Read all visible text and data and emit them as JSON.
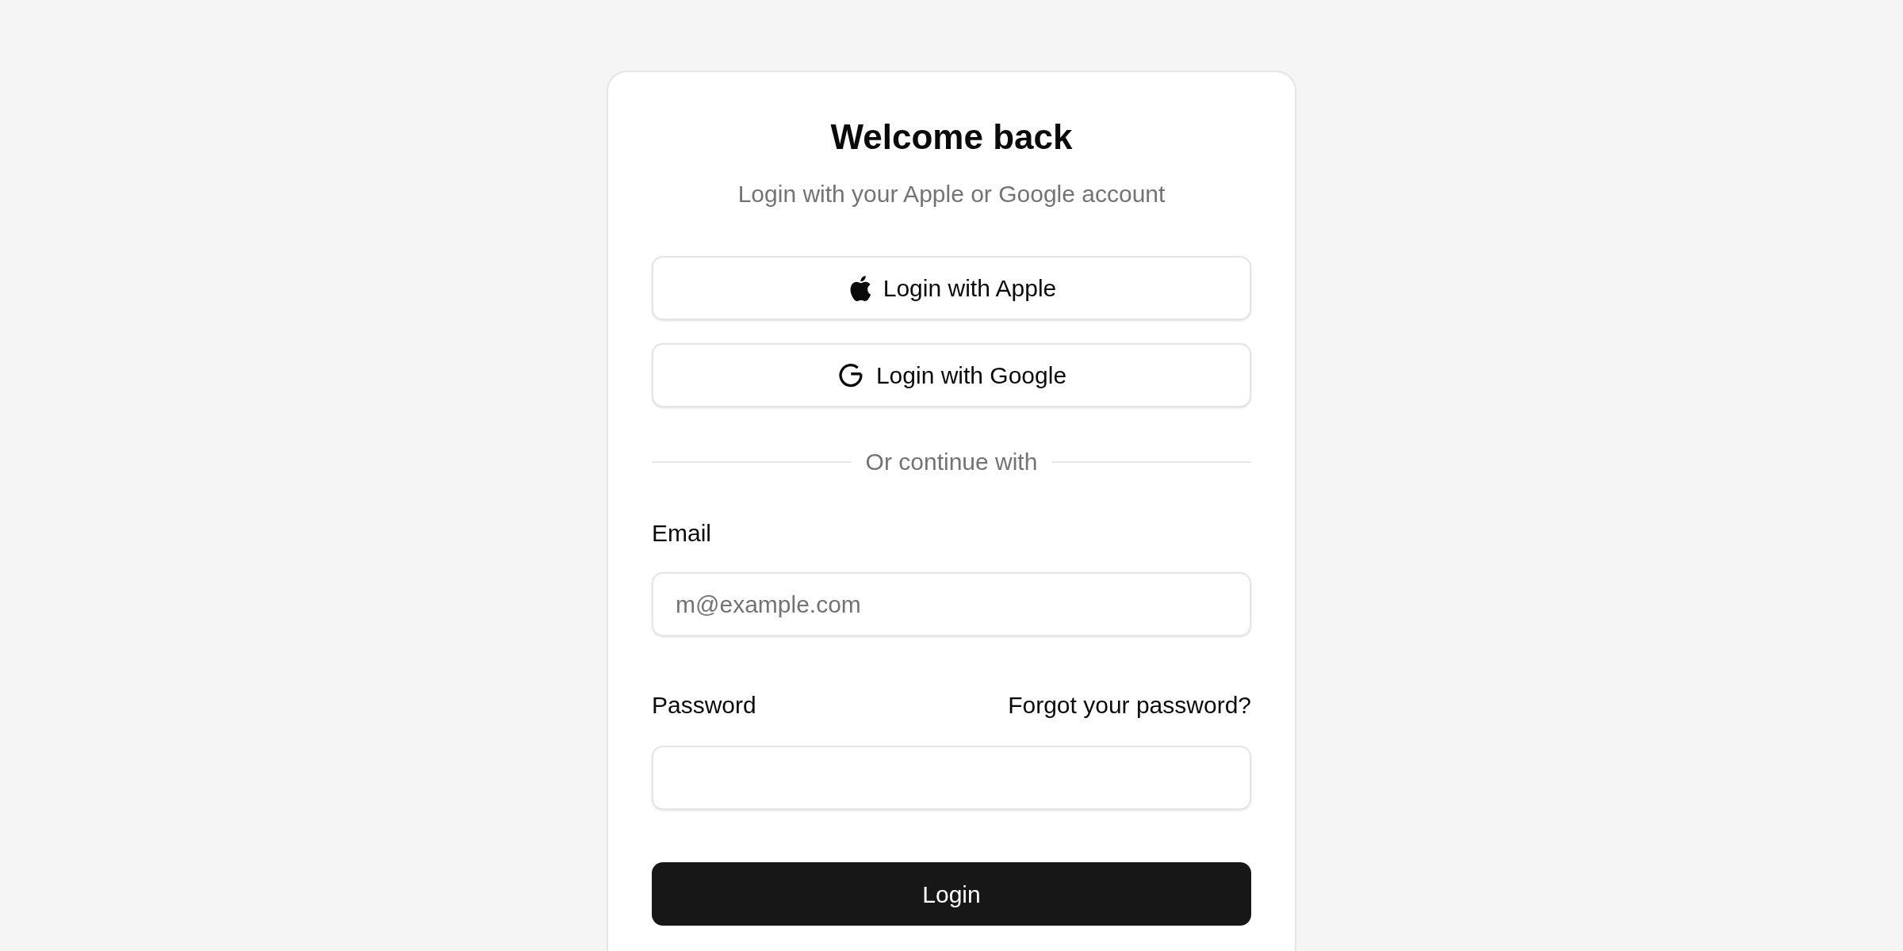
{
  "card": {
    "title": "Welcome back",
    "subtitle": "Login with your Apple or Google account",
    "social_buttons": [
      {
        "kind": "apple",
        "label": "Login with Apple"
      },
      {
        "kind": "google",
        "label": "Login with Google"
      }
    ],
    "divider_text": "Or continue with",
    "fields": [
      {
        "label": "Email",
        "placeholder": "m@example.com"
      },
      {
        "label": "Password",
        "link": "Forgot your password?"
      }
    ],
    "submit": "Login"
  }
}
